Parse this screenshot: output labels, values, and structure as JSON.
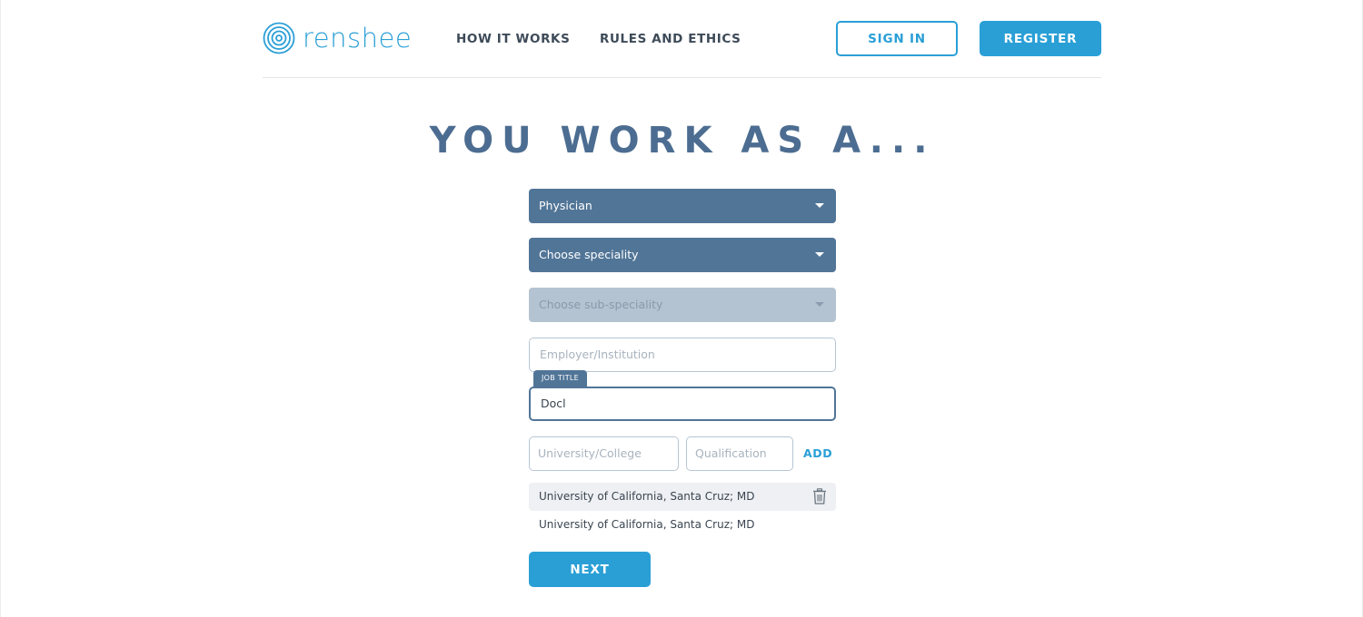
{
  "header": {
    "logo_text": "renshee",
    "nav": {
      "how_it_works": "HOW IT WORKS",
      "rules_and_ethics": "RULES AND ETHICS"
    },
    "sign_in_label": "SIGN IN",
    "register_label": "REGISTER"
  },
  "main": {
    "title": "YOU WORK AS A...",
    "profession_select": {
      "selected": "Physician"
    },
    "speciality_select": {
      "selected": "Choose speciality"
    },
    "sub_speciality_select": {
      "selected": "Choose sub-speciality",
      "disabled": true
    },
    "employer_input": {
      "value": "",
      "placeholder": "Employer/Institution"
    },
    "job_title_input": {
      "label": "JOB TITLE",
      "value": "Docl",
      "placeholder": ""
    },
    "university_input": {
      "value": "",
      "placeholder": "University/College"
    },
    "qualification_input": {
      "value": "",
      "placeholder": "Qualification"
    },
    "add_label": "ADD",
    "education_list": [
      {
        "text": "University of California, Santa Cruz; MD"
      },
      {
        "text": "University of California, Santa Cruz; MD"
      }
    ],
    "next_label": "NEXT"
  },
  "colors": {
    "brand_blue": "#2a9fd6",
    "select_blue": "#517597",
    "title_blue": "#4c6d91",
    "disabled_select": "#b4c3d1"
  },
  "icons": {
    "logo": "concentric-circles-icon",
    "dropdown": "caret-down-icon",
    "delete": "trash-icon"
  }
}
